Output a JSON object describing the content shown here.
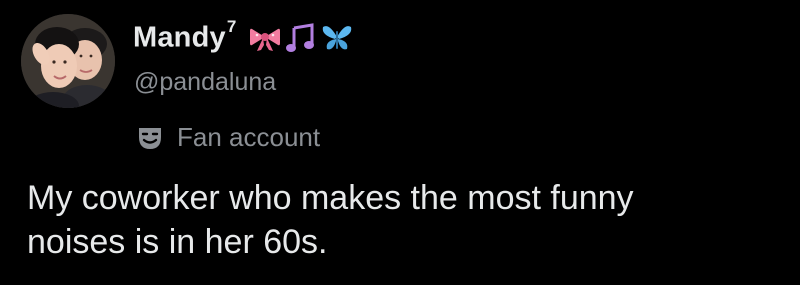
{
  "author": {
    "display_name": "Mandy",
    "display_name_superscript": "7",
    "handle": "@pandaluna",
    "emojis": [
      "ribbon-icon",
      "music-notes-icon",
      "butterfly-icon"
    ]
  },
  "badge": {
    "icon": "theater-mask-icon",
    "label": "Fan account"
  },
  "tweet": {
    "text": "My coworker who makes the most funny\nnoises is in her 60s."
  },
  "colors": {
    "background": "#000000",
    "primary_text": "#e7e9ea",
    "secondary_text": "#8b8f94",
    "ribbon": "#f27ca0",
    "music": "#b27fe0",
    "butterfly": "#5cb8f0"
  }
}
